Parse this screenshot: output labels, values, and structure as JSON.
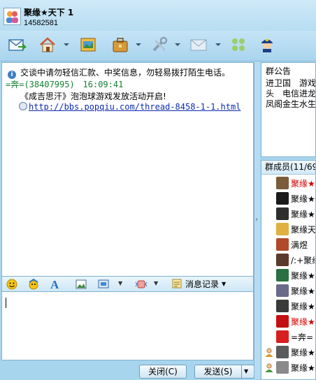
{
  "window": {
    "title": "聚缘★天下 1",
    "group_id": "14582581"
  },
  "toolbar": {
    "buttons": [
      {
        "icon": "message-icon"
      },
      {
        "icon": "home-icon"
      },
      {
        "icon": "album-icon"
      },
      {
        "icon": "briefcase-icon"
      },
      {
        "icon": "tools-icon"
      },
      {
        "icon": "email-icon"
      },
      {
        "icon": "group-apps-icon"
      },
      {
        "icon": "admin-icon"
      }
    ]
  },
  "chat": {
    "system_notice": "交谈中请勿轻信汇款、中奖信息，勿轻易拨打陌生电话。",
    "messages": [
      {
        "sender": "=奔=(38407995)",
        "time": "16:09:41",
        "text": "《成吉思汗》泡泡球游戏发放活动开启!",
        "link": "http://bbs.popqiu.com/thread-8458-1-1.html"
      }
    ]
  },
  "input_toolbar": {
    "history_label": "消息记录"
  },
  "buttons": {
    "close": "关闭(C)",
    "send": "发送(S)"
  },
  "announcement": {
    "title": "群公告",
    "lines": [
      "进卫国　游戏",
      "头　电信进龙",
      "凤阁金生水生"
    ]
  },
  "members": {
    "header": "群成员(11/69)",
    "list": [
      {
        "name": "聚缘★",
        "color": "#d40000",
        "status": "",
        "avatar": "#7a5c3a"
      },
      {
        "name": "聚缘★",
        "color": "#000000",
        "status": "",
        "avatar": "#1a1a1a"
      },
      {
        "name": "聚缘★",
        "color": "#000000",
        "status": "",
        "avatar": "#2e2e2e"
      },
      {
        "name": "聚缘天",
        "color": "#000000",
        "status": "",
        "avatar": "#e0b040"
      },
      {
        "name": "满煜",
        "color": "#000000",
        "status": "",
        "avatar": "#b04a2a"
      },
      {
        "name": "/:+聚缘",
        "color": "#000000",
        "status": "",
        "avatar": "#5a3a2a"
      },
      {
        "name": "聚缘★",
        "color": "#000000",
        "status": "",
        "avatar": "#2a7040"
      },
      {
        "name": "聚缘★",
        "color": "#000000",
        "status": "",
        "avatar": "#6a6a8a"
      },
      {
        "name": "聚缘★",
        "color": "#000000",
        "status": "",
        "avatar": "#3a3a3a"
      },
      {
        "name": "聚缘★",
        "color": "#d40000",
        "status": "",
        "avatar": "#c41010"
      },
      {
        "name": "=奔=",
        "color": "#000000",
        "status": "",
        "avatar": "#d81e1e"
      },
      {
        "name": "聚缘★",
        "color": "#000000",
        "status": "manager",
        "avatar": "#5b5b5b"
      },
      {
        "name": "聚缘★",
        "color": "#000000",
        "status": "member",
        "avatar": "#8a8a8a"
      }
    ]
  }
}
